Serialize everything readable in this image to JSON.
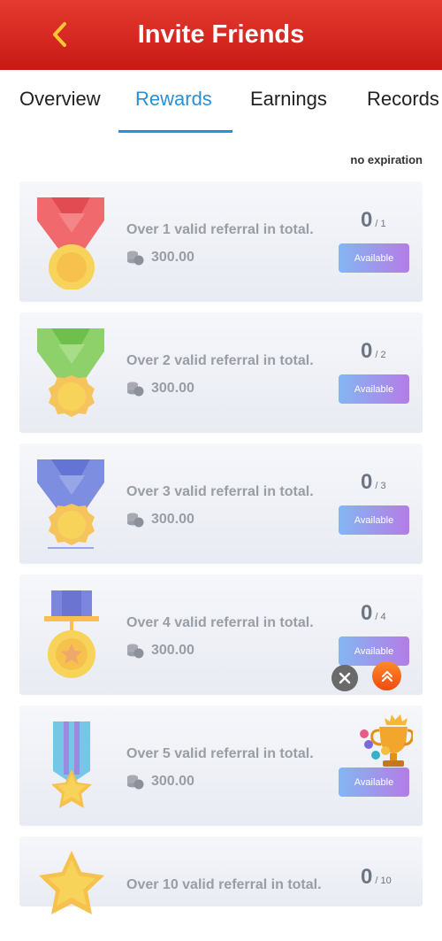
{
  "header": {
    "title": "Invite Friends",
    "back_icon": "chevron-left-icon"
  },
  "tabs": [
    {
      "label": "Overview",
      "active": false
    },
    {
      "label": "Rewards",
      "active": true
    },
    {
      "label": "Earnings",
      "active": false
    },
    {
      "label": "Records",
      "active": false
    }
  ],
  "note": "no expiration",
  "colors": {
    "header": "#d32a22",
    "accent": "#2a8fd6",
    "button_start": "#84b6f2",
    "button_end": "#b47ce6"
  },
  "rewards": [
    {
      "desc": "Over 1 valid referral in total.",
      "amount": "300.00",
      "current": "0",
      "target": "/ 1",
      "button": "Available",
      "medal_icon": "red-ribbon-gold-medal-icon"
    },
    {
      "desc": "Over 2 valid referral in total.",
      "amount": "300.00",
      "current": "0",
      "target": "/ 2",
      "button": "Available",
      "medal_icon": "green-ribbon-gold-medal-icon"
    },
    {
      "desc": "Over 3 valid referral in total.",
      "amount": "300.00",
      "current": "0",
      "target": "/ 3",
      "button": "Available",
      "medal_icon": "blue-ribbon-gold-medal-icon"
    },
    {
      "desc": "Over 4 valid referral in total.",
      "amount": "300.00",
      "current": "0",
      "target": "/ 4",
      "button": "Available",
      "medal_icon": "bar-star-medal-icon"
    },
    {
      "desc": "Over 5 valid referral in total.",
      "amount": "300.00",
      "current": "0",
      "target": "/ 5",
      "button": "Available",
      "medal_icon": "star-ribbon-medal-icon"
    },
    {
      "desc": "Over 10 valid referral in total.",
      "current": "0",
      "target": "/ 10",
      "medal_icon": "star-medal-icon"
    }
  ],
  "floating": {
    "close_icon": "close-icon",
    "scroll_top_icon": "double-chevron-up-icon",
    "promo_icon": "trophy-icon"
  }
}
